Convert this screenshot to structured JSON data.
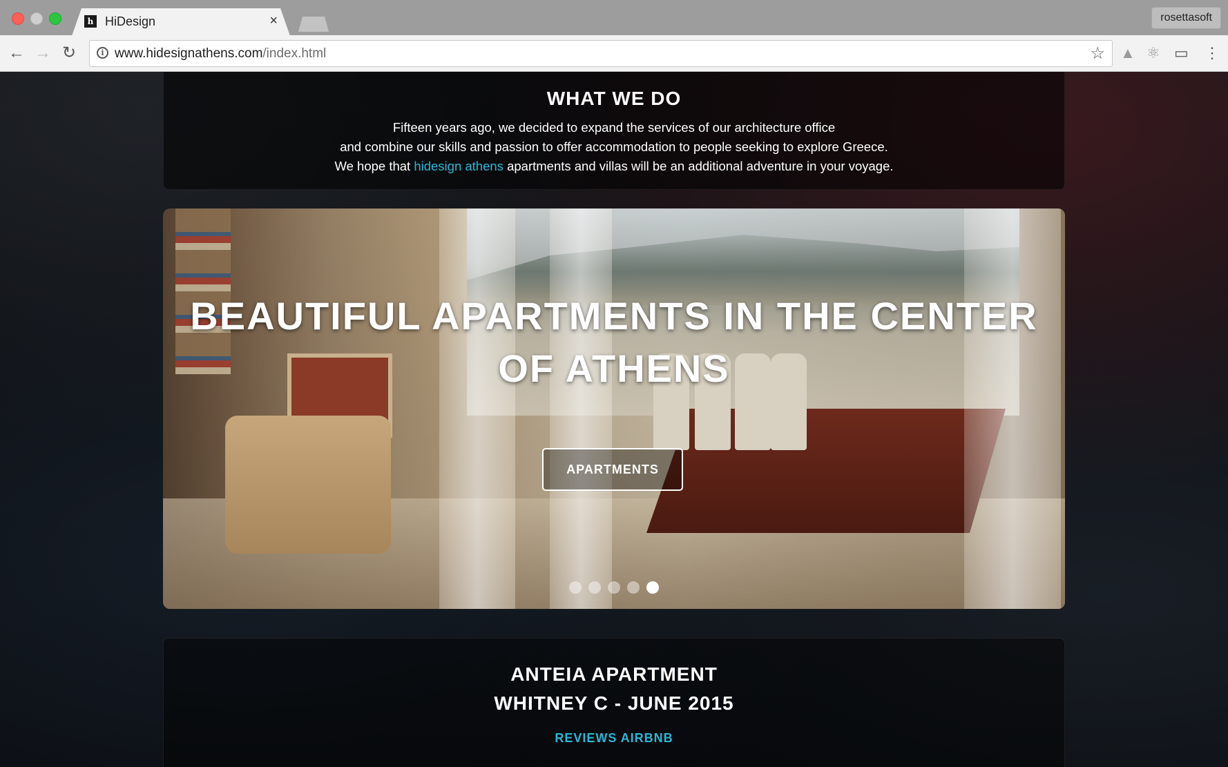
{
  "browser": {
    "tab_title": "HiDesign",
    "url_host": "www.hidesignathens.com",
    "url_path": "/index.html",
    "profile_name": "rosettasoft"
  },
  "what_we_do": {
    "title": "WHAT WE DO",
    "line1": "Fifteen years ago, we decided to expand the services of our architecture office",
    "line2": "and combine our skills and passion to offer accommodation to people seeking to explore Greece.",
    "line3_before": "We hope that ",
    "line3_link": "hidesign athens",
    "line3_after": " apartments and villas will be an additional adventure in your voyage."
  },
  "slider": {
    "heading_line1": "BEAUTIFUL APARTMENTS IN THE CENTER",
    "heading_line2": "OF ATHENS",
    "button_label": "APARTMENTS",
    "dot_count": 5,
    "active_dot": 5
  },
  "review": {
    "line1": "ANTEIA APARTMENT",
    "line2": "WHITNEY C - JUNE 2015",
    "link_label": "REVIEWS AIRBNB"
  },
  "colors": {
    "accent": "#2bb7d6",
    "page_bg": "#0b0d10"
  }
}
